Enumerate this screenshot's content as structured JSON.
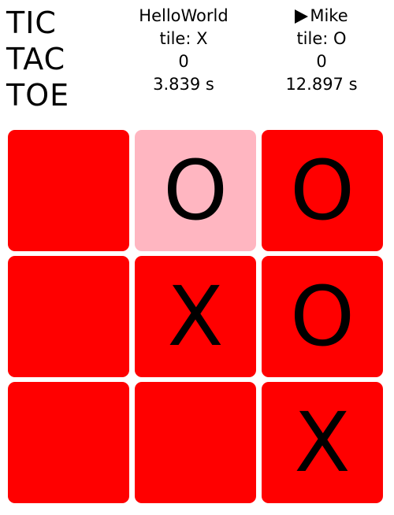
{
  "title": {
    "lines": [
      "TIC",
      "TAC",
      "TOE"
    ]
  },
  "players": [
    {
      "name": "HelloWorld",
      "tile": "tile: X",
      "score": "0",
      "time": "3.839 s",
      "is_turn": false
    },
    {
      "name": "Mike",
      "tile": "tile: O",
      "score": "0",
      "time": "12.897 s",
      "is_turn": true
    }
  ],
  "board": {
    "cells": [
      {
        "mark": "",
        "highlighted": false
      },
      {
        "mark": "O",
        "highlighted": true
      },
      {
        "mark": "O",
        "highlighted": false
      },
      {
        "mark": "",
        "highlighted": false
      },
      {
        "mark": "X",
        "highlighted": false
      },
      {
        "mark": "O",
        "highlighted": false
      },
      {
        "mark": "",
        "highlighted": false
      },
      {
        "mark": "",
        "highlighted": false
      },
      {
        "mark": "X",
        "highlighted": false
      }
    ]
  },
  "colors": {
    "cell": "#ff0000",
    "cell_highlight": "#ffb6c1",
    "mark": "#000000",
    "background": "#ffffff"
  },
  "icons": {
    "turn_indicator": "play-triangle-icon"
  }
}
